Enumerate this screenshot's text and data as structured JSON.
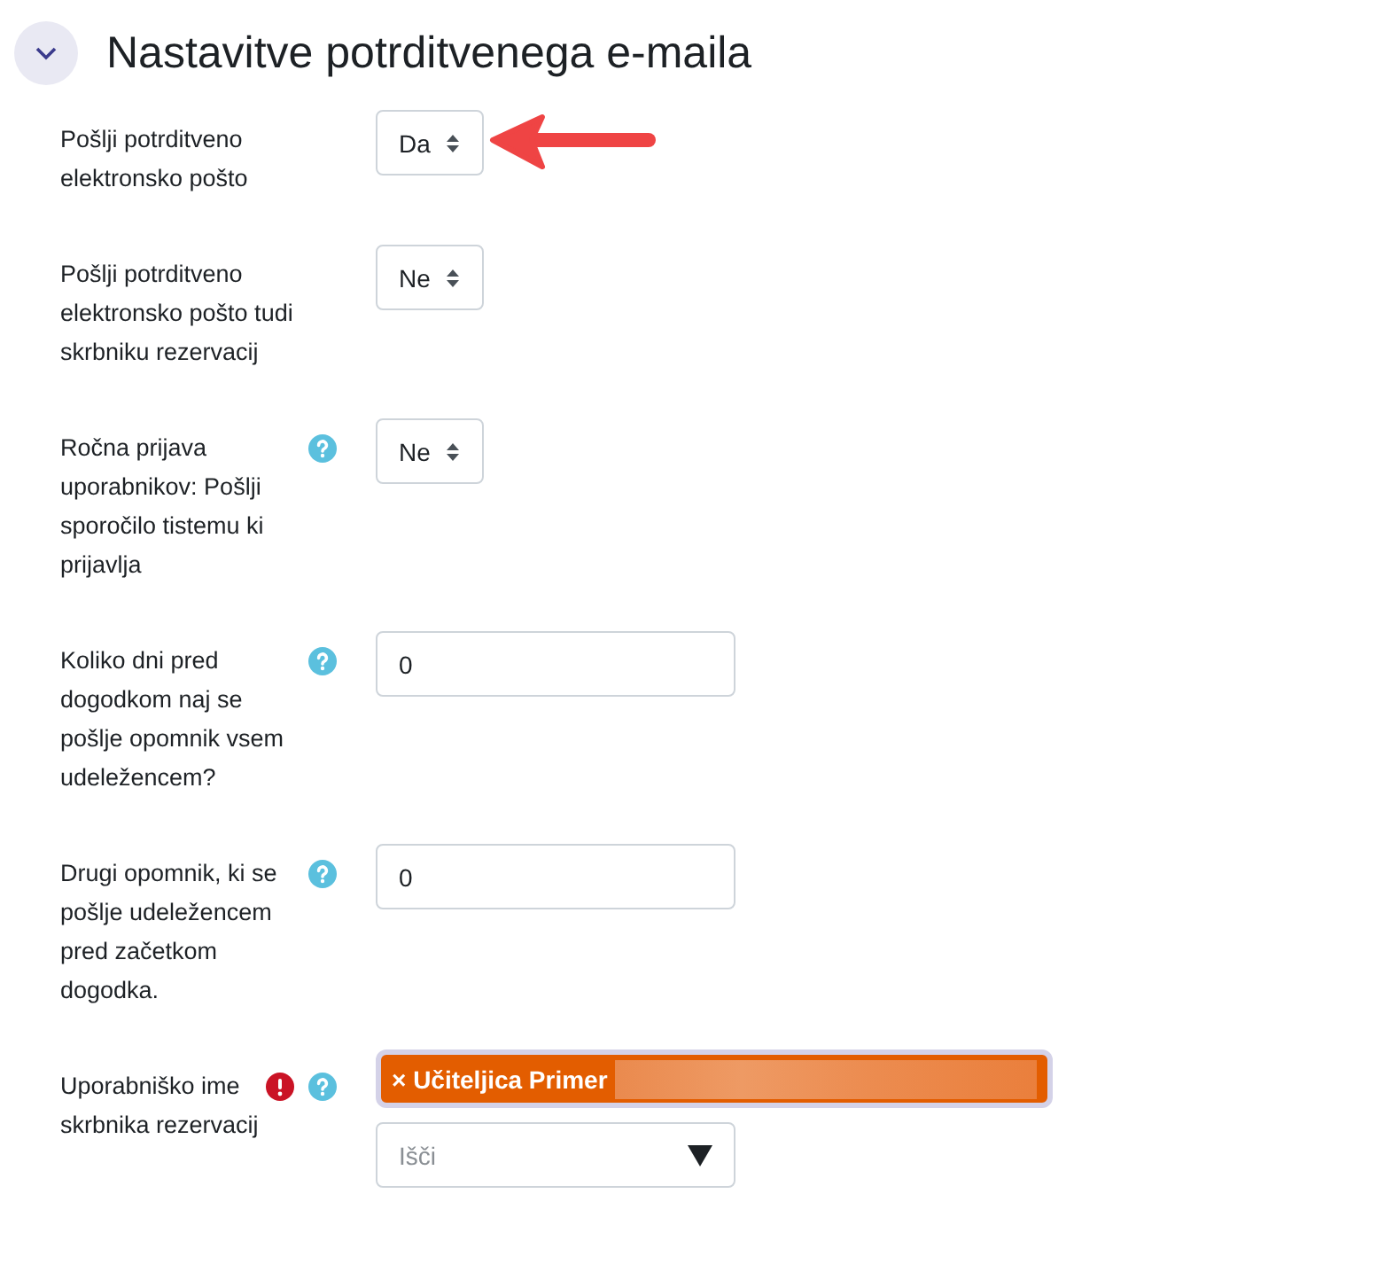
{
  "section": {
    "title": "Nastavitve potrditvenega e-maila",
    "expanded": true
  },
  "fields": [
    {
      "kind": "select",
      "label": "Pošlji potrditveno elektronsko pošto",
      "required": false,
      "help": false,
      "value": "Da",
      "annotated": true
    },
    {
      "kind": "select",
      "label": "Pošlji potrditveno elektronsko pošto tudi skrbniku rezervacij",
      "required": false,
      "help": false,
      "value": "Ne",
      "annotated": false
    },
    {
      "kind": "select",
      "label": "Ročna prijava uporabnikov: Pošlji sporočilo tistemu ki prijavlja",
      "required": false,
      "help": true,
      "value": "Ne",
      "annotated": false
    },
    {
      "kind": "text",
      "label": "Koliko dni pred dogodkom naj se pošlje opomnik vsem udeležencem?",
      "required": false,
      "help": true,
      "value": "0",
      "annotated": false
    },
    {
      "kind": "text",
      "label": "Drugi opomnik, ki se pošlje udeležencem pred začetkom dogodka.",
      "required": false,
      "help": true,
      "value": "0",
      "annotated": false
    },
    {
      "kind": "autocomplete",
      "label": "Uporabniško ime skrbnika rezervacij",
      "required": true,
      "help": true,
      "chips": [
        "× Učiteljica Primer"
      ],
      "placeholder": "Išči",
      "annotated": false
    }
  ]
}
